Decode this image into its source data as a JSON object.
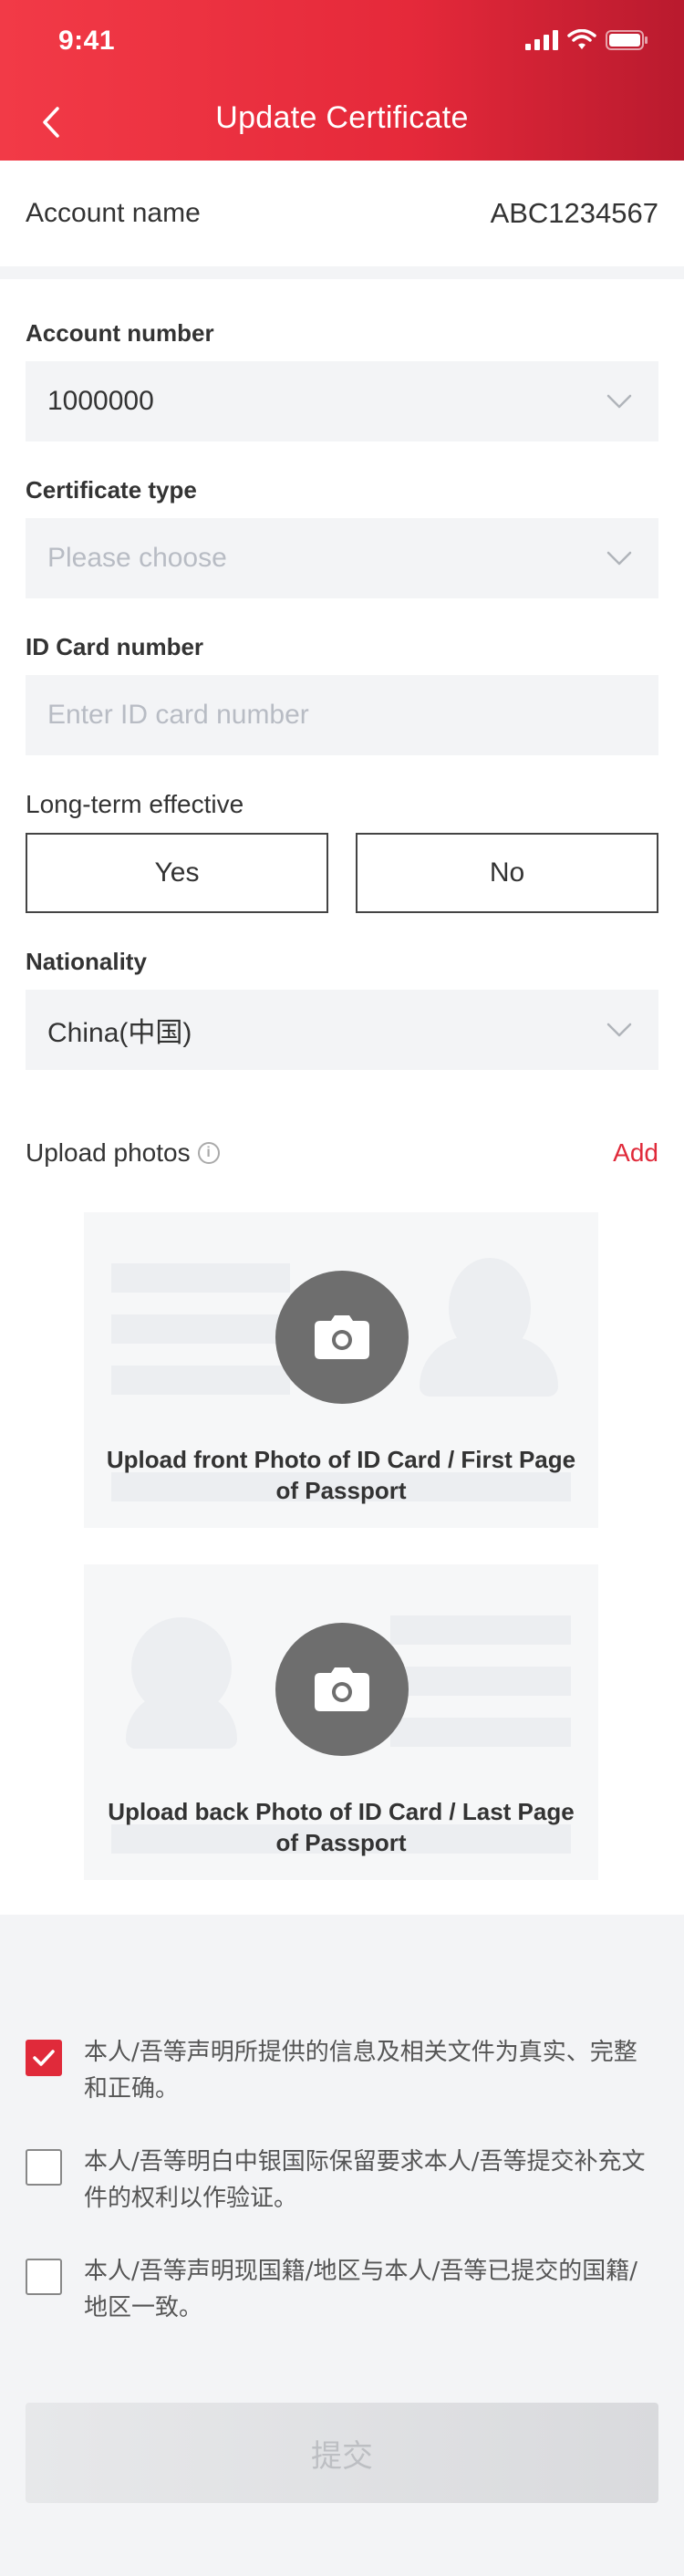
{
  "status_bar": {
    "time": "9:41"
  },
  "nav": {
    "title": "Update Certificate"
  },
  "account_name": {
    "label": "Account name",
    "value": "ABC1234567"
  },
  "account_number": {
    "label": "Account number",
    "value": "1000000"
  },
  "certificate_type": {
    "label": "Certificate type",
    "placeholder": "Please choose"
  },
  "id_card": {
    "label": "ID Card number",
    "placeholder": "Enter ID card number"
  },
  "long_term": {
    "label": "Long-term effective",
    "yes_label": "Yes",
    "no_label": "No"
  },
  "nationality": {
    "label": "Nationality",
    "value": "China(中国)"
  },
  "upload": {
    "label": "Upload photos",
    "add_label": "Add",
    "front_caption": "Upload front Photo of ID Card / First Page of Passport",
    "back_caption": "Upload back Photo of ID Card / Last Page of Passport"
  },
  "declarations": [
    {
      "text": "本人/吾等声明所提供的信息及相关文件为真实、完整和正确。",
      "checked": true
    },
    {
      "text": "本人/吾等明白中银国际保留要求本人/吾等提交补充文件的权利以作验证。",
      "checked": false
    },
    {
      "text": "本人/吾等声明现国籍/地区与本人/吾等已提交的国籍/地区一致。",
      "checked": false
    }
  ],
  "submit": {
    "label": "提交"
  },
  "colors": {
    "brand_red": "#e5293a",
    "accent_red": "#e02a3a"
  }
}
